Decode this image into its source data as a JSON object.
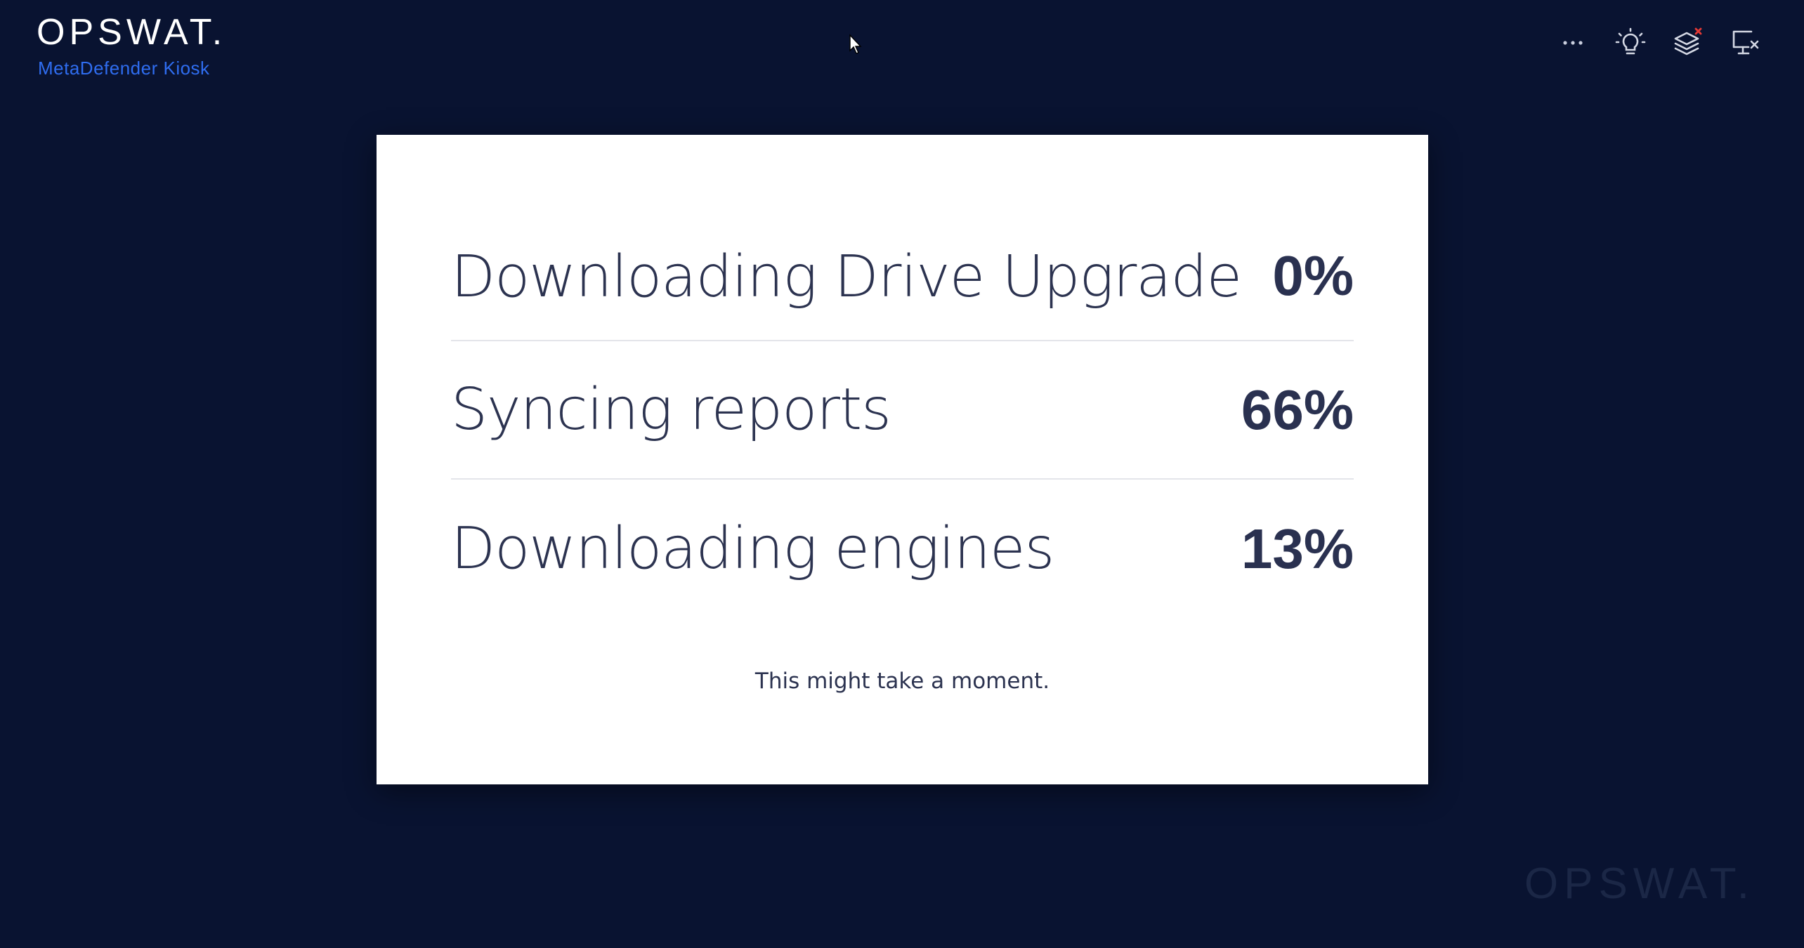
{
  "header": {
    "logo_text": "OPSWAT.",
    "product_name": "MetaDefender Kiosk"
  },
  "toolbar": {
    "icons": [
      "more-icon",
      "lightbulb-icon",
      "layers-alert-icon",
      "monitor-disconnect-icon"
    ]
  },
  "progress": {
    "items": [
      {
        "label": "Downloading Drive Upgrade",
        "percent": "0%"
      },
      {
        "label": "Syncing reports",
        "percent": "66%"
      },
      {
        "label": "Downloading engines",
        "percent": "13%"
      }
    ],
    "note": "This might take a moment."
  },
  "watermark": {
    "text": "OPSWAT."
  },
  "colors": {
    "background": "#091331",
    "accent": "#2f6df0",
    "card": "#ffffff",
    "text_dark": "#2c3350",
    "alert": "#e53935"
  }
}
